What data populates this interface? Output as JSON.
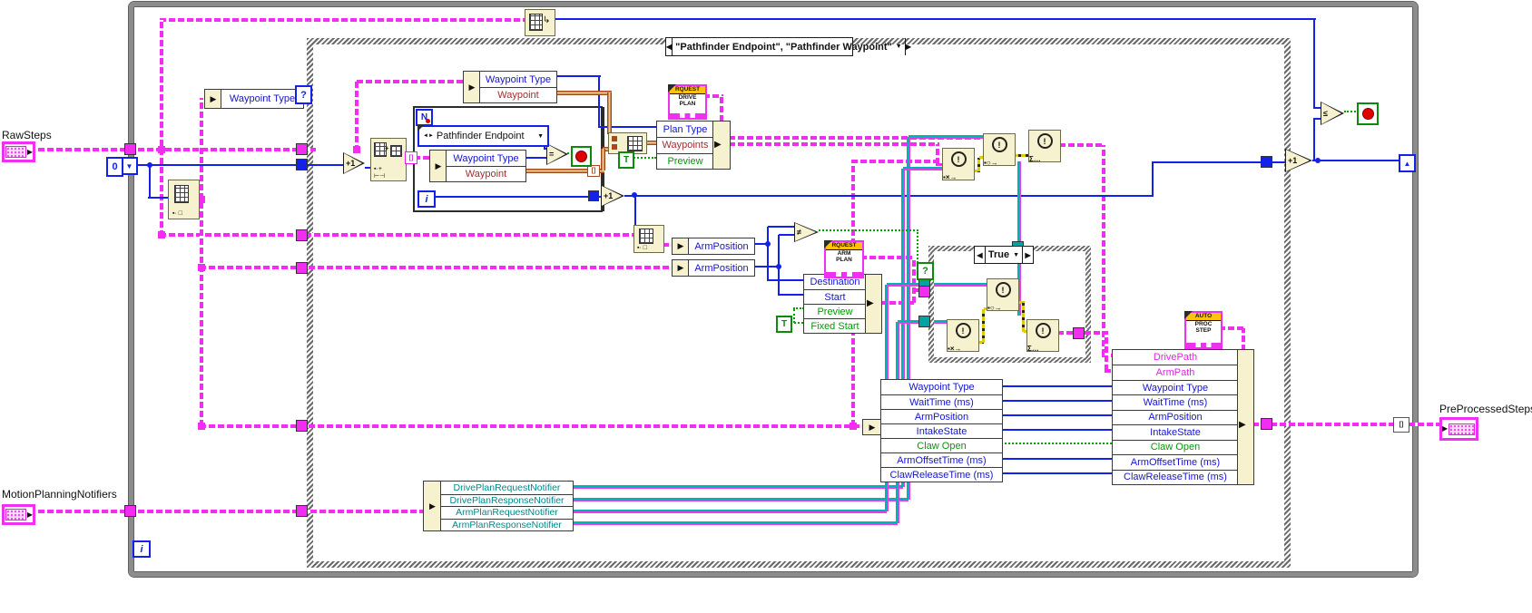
{
  "labels": {
    "raw_steps": "RawSteps",
    "motion_planning_notifiers": "MotionPlanningNotifiers",
    "pre_processed_steps": "PreProcessedSteps"
  },
  "outer_loop": {
    "iteration": "i",
    "init_value": "0",
    "shift_left": "▼",
    "shift_right": "▲"
  },
  "case_structure": {
    "prev": "◀",
    "next": "▶",
    "dropdown": "▼",
    "selector": "\"Pathfinder Endpoint\", \"Pathfinder Waypoint\"",
    "selector_terminal": "?"
  },
  "true_case": {
    "prev": "◀",
    "next": "▶",
    "dropdown": "▼",
    "selector": "True",
    "selector_terminal": "?"
  },
  "inner_loop": {
    "count": "N",
    "iteration": "i"
  },
  "enum_constant": {
    "value": "Pathfinder Endpoint",
    "glyph": "◄►",
    "dropdown": "▼"
  },
  "constants": {
    "zero": "0",
    "bool_true": "T"
  },
  "glyphs": {
    "increment": "+1",
    "equal": "=",
    "not_equal": "≠",
    "less_equal": "≤",
    "bang": "!",
    "send_notification": "▪×→",
    "wait_notification": "▪○→",
    "wait_ms": "Σ…",
    "nub": "▶",
    "spine_arrow": "▶",
    "auto_index": "[]",
    "array_hook": "↳",
    "term_arrow": "▶"
  },
  "vi_icons": {
    "request_drive_plan": {
      "banner": "RQUEST",
      "line1": "DRIVE",
      "line2": "PLAN"
    },
    "request_arm_plan": {
      "banner": "RQUEST",
      "line1": "ARM",
      "line2": "PLAN"
    },
    "auto_proc_step": {
      "banner": "AUTO",
      "line1": "PROC",
      "line2": "STEP"
    }
  },
  "clusters": {
    "waypoint_type_probe": {
      "rows": [
        {
          "label": "Waypoint Type",
          "color": "blue"
        }
      ]
    },
    "step_unbundle_top": {
      "rows": [
        {
          "label": "Waypoint Type",
          "color": "blue"
        },
        {
          "label": "Waypoint",
          "color": "maroon"
        }
      ]
    },
    "step_unbundle_loop": {
      "rows": [
        {
          "label": "Waypoint Type",
          "color": "blue"
        },
        {
          "label": "Waypoint",
          "color": "maroon"
        }
      ]
    },
    "drive_plan_bundle": {
      "rows": [
        {
          "label": "Plan Type",
          "color": "blue"
        },
        {
          "label": "Waypoints",
          "color": "maroon"
        },
        {
          "label": "Preview",
          "color": "green"
        }
      ]
    },
    "arm_position_a": {
      "rows": [
        {
          "label": "ArmPosition",
          "color": "blue"
        }
      ]
    },
    "arm_position_b": {
      "rows": [
        {
          "label": "ArmPosition",
          "color": "blue"
        }
      ]
    },
    "arm_plan_bundle": {
      "rows": [
        {
          "label": "Destination",
          "color": "blue"
        },
        {
          "label": "Start",
          "color": "blue"
        },
        {
          "label": "Preview",
          "color": "green"
        },
        {
          "label": "Fixed Start",
          "color": "green"
        }
      ]
    },
    "notifier_unbundle": {
      "rows": [
        {
          "label": "DrivePlanRequestNotifier",
          "color": "teal"
        },
        {
          "label": "DrivePlanResponseNotifier",
          "color": "teal"
        },
        {
          "label": "ArmPlanRequestNotifier",
          "color": "teal"
        },
        {
          "label": "ArmPlanResponseNotifier",
          "color": "teal"
        }
      ]
    },
    "step_unbundle_right": {
      "rows": [
        {
          "label": "Waypoint Type",
          "color": "blue"
        },
        {
          "label": "WaitTime (ms)",
          "color": "blue"
        },
        {
          "label": "ArmPosition",
          "color": "blue"
        },
        {
          "label": "IntakeState",
          "color": "blue"
        },
        {
          "label": "Claw Open",
          "color": "green"
        },
        {
          "label": "ArmOffsetTime (ms)",
          "color": "blue"
        },
        {
          "label": "ClawReleaseTime (ms)",
          "color": "blue"
        }
      ]
    },
    "step_bundle_right": {
      "rows": [
        {
          "label": "DrivePath",
          "color": "magenta"
        },
        {
          "label": "ArmPath",
          "color": "magenta"
        },
        {
          "label": "Waypoint Type",
          "color": "blue"
        },
        {
          "label": "WaitTime (ms)",
          "color": "blue"
        },
        {
          "label": "ArmPosition",
          "color": "blue"
        },
        {
          "label": "IntakeState",
          "color": "blue"
        },
        {
          "label": "Claw Open",
          "color": "green"
        },
        {
          "label": "ArmOffsetTime (ms)",
          "color": "blue"
        },
        {
          "label": "ClawReleaseTime (ms)",
          "color": "blue"
        }
      ]
    }
  },
  "colors": {
    "wire_cluster_pink": "#F22DF2",
    "wire_numeric_blue": "#1322E8",
    "wire_notifier_teal": "#00B3B3",
    "wire_error_yellow": "#DDCC00",
    "wire_boolean_green": "#00A400",
    "wire_2d_array_brown": "#A5491F",
    "node_fill": "#F6F2CF",
    "vi_border": "#F030F0",
    "vi_banner": "#FFC20E",
    "loop_border": "#8C8C8C"
  }
}
